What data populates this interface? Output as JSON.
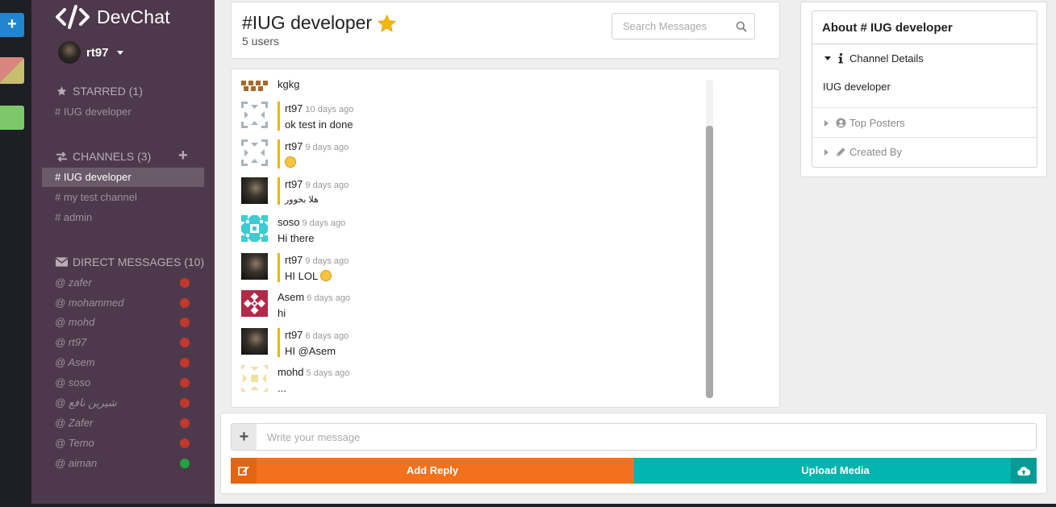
{
  "app": {
    "name": "DevChat"
  },
  "user": {
    "name": "rt97"
  },
  "sidebar": {
    "starred": {
      "title": "STARRED (1)",
      "items": [
        "# IUG developer"
      ]
    },
    "channels": {
      "title": "CHANNELS (3)",
      "items": [
        "# IUG developer",
        "# my test channel",
        "# admin"
      ],
      "active": 0
    },
    "direct": {
      "title": "DIRECT MESSAGES (10)",
      "items": [
        {
          "label": "@ zafer",
          "status": "offline"
        },
        {
          "label": "@ mohammed",
          "status": "offline"
        },
        {
          "label": "@ mohd",
          "status": "offline"
        },
        {
          "label": "@ rt97",
          "status": "offline"
        },
        {
          "label": "@ Asem",
          "status": "offline"
        },
        {
          "label": "@ soso",
          "status": "offline"
        },
        {
          "label": "@ شيرين نافع",
          "status": "offline"
        },
        {
          "label": "@ Zafer",
          "status": "offline"
        },
        {
          "label": "@ Temo",
          "status": "offline"
        },
        {
          "label": "@ aiman",
          "status": "online"
        }
      ]
    }
  },
  "header": {
    "title": "#IUG developer",
    "users": "5 users",
    "search_placeholder": "Search Messages"
  },
  "messages": [
    {
      "name": "",
      "time": "",
      "text": "kgkg",
      "avatar": "pattern-brown"
    },
    {
      "name": "rt97",
      "time": "10 days ago",
      "text": "ok test in done",
      "avatar": "pattern-gray"
    },
    {
      "name": "rt97",
      "time": "9 days ago",
      "text": "",
      "emoji": "smile-face",
      "avatar": "pattern-gray"
    },
    {
      "name": "rt97",
      "time": "9 days ago",
      "text": "هلا بخوور",
      "avatar": "photo"
    },
    {
      "name": "soso",
      "time": "9 days ago",
      "text": "Hi there",
      "avatar": "pattern-teal"
    },
    {
      "name": "rt97",
      "time": "9 days ago",
      "text": "HI LOL",
      "emoji": "tongue-face",
      "avatar": "photo"
    },
    {
      "name": "Asem",
      "time": "6 days ago",
      "text": "hi",
      "avatar": "pattern-red"
    },
    {
      "name": "rt97",
      "time": "6 days ago",
      "text": "HI @Asem",
      "avatar": "photo"
    },
    {
      "name": "mohd",
      "time": "5 days ago",
      "text": "...",
      "avatar": "pattern-yellow"
    }
  ],
  "about": {
    "title": "About # IUG developer",
    "details_label": "Channel Details",
    "description": "IUG developer",
    "top_posters": "Top Posters",
    "created_by": "Created By"
  },
  "composer": {
    "placeholder": "Write your message",
    "reply_label": "Add Reply",
    "upload_label": "Upload Media"
  },
  "colors": {
    "sidebar": "#4d394b",
    "reply": "#f2711c",
    "upload": "#00b5ad",
    "offline": "#c0392b",
    "online": "#21a33d",
    "star": "#f5b800"
  }
}
